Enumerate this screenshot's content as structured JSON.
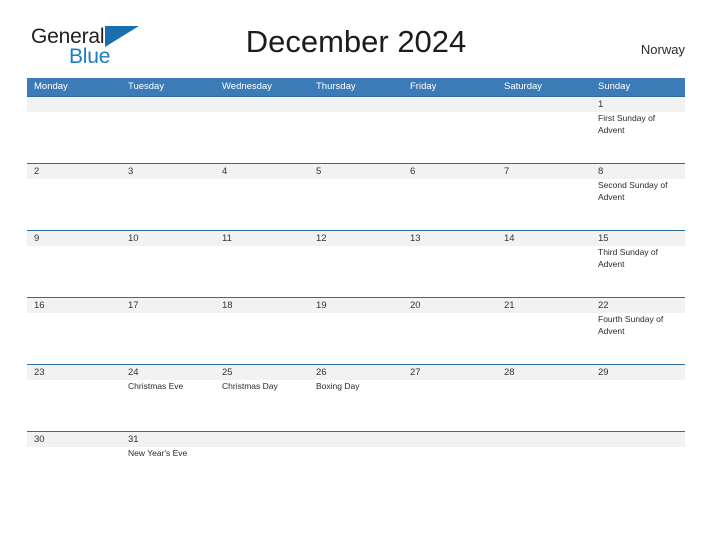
{
  "logo": {
    "text_general": "General",
    "text_blue": "Blue",
    "flag_icon": "blue-flag-triangle",
    "color_general": "#231f20",
    "color_blue": "#1a7fc1"
  },
  "header": {
    "title": "December 2024",
    "country": "Norway"
  },
  "theme": {
    "header_blue": "#3b7cb8",
    "row_border_blue": "#2e6da4",
    "date_band_gray": "#f2f2f2",
    "text_color": "#2b2b2b",
    "page_background": "#ffffff"
  },
  "calendar": {
    "weekdays": [
      "Monday",
      "Tuesday",
      "Wednesday",
      "Thursday",
      "Friday",
      "Saturday",
      "Sunday"
    ],
    "weeks": [
      [
        {
          "date": "",
          "events": ""
        },
        {
          "date": "",
          "events": ""
        },
        {
          "date": "",
          "events": ""
        },
        {
          "date": "",
          "events": ""
        },
        {
          "date": "",
          "events": ""
        },
        {
          "date": "",
          "events": ""
        },
        {
          "date": "1",
          "events": "First Sunday of Advent"
        }
      ],
      [
        {
          "date": "2",
          "events": ""
        },
        {
          "date": "3",
          "events": ""
        },
        {
          "date": "4",
          "events": ""
        },
        {
          "date": "5",
          "events": ""
        },
        {
          "date": "6",
          "events": ""
        },
        {
          "date": "7",
          "events": ""
        },
        {
          "date": "8",
          "events": "Second Sunday of Advent"
        }
      ],
      [
        {
          "date": "9",
          "events": ""
        },
        {
          "date": "10",
          "events": ""
        },
        {
          "date": "11",
          "events": ""
        },
        {
          "date": "12",
          "events": ""
        },
        {
          "date": "13",
          "events": ""
        },
        {
          "date": "14",
          "events": ""
        },
        {
          "date": "15",
          "events": "Third Sunday of Advent"
        }
      ],
      [
        {
          "date": "16",
          "events": ""
        },
        {
          "date": "17",
          "events": ""
        },
        {
          "date": "18",
          "events": ""
        },
        {
          "date": "19",
          "events": ""
        },
        {
          "date": "20",
          "events": ""
        },
        {
          "date": "21",
          "events": ""
        },
        {
          "date": "22",
          "events": "Fourth Sunday of Advent"
        }
      ],
      [
        {
          "date": "23",
          "events": ""
        },
        {
          "date": "24",
          "events": "Christmas Eve"
        },
        {
          "date": "25",
          "events": "Christmas Day"
        },
        {
          "date": "26",
          "events": "Boxing Day"
        },
        {
          "date": "27",
          "events": ""
        },
        {
          "date": "28",
          "events": ""
        },
        {
          "date": "29",
          "events": ""
        }
      ],
      [
        {
          "date": "30",
          "events": ""
        },
        {
          "date": "31",
          "events": "New Year's Eve"
        },
        {
          "date": "",
          "events": ""
        },
        {
          "date": "",
          "events": ""
        },
        {
          "date": "",
          "events": ""
        },
        {
          "date": "",
          "events": ""
        },
        {
          "date": "",
          "events": ""
        }
      ]
    ]
  }
}
